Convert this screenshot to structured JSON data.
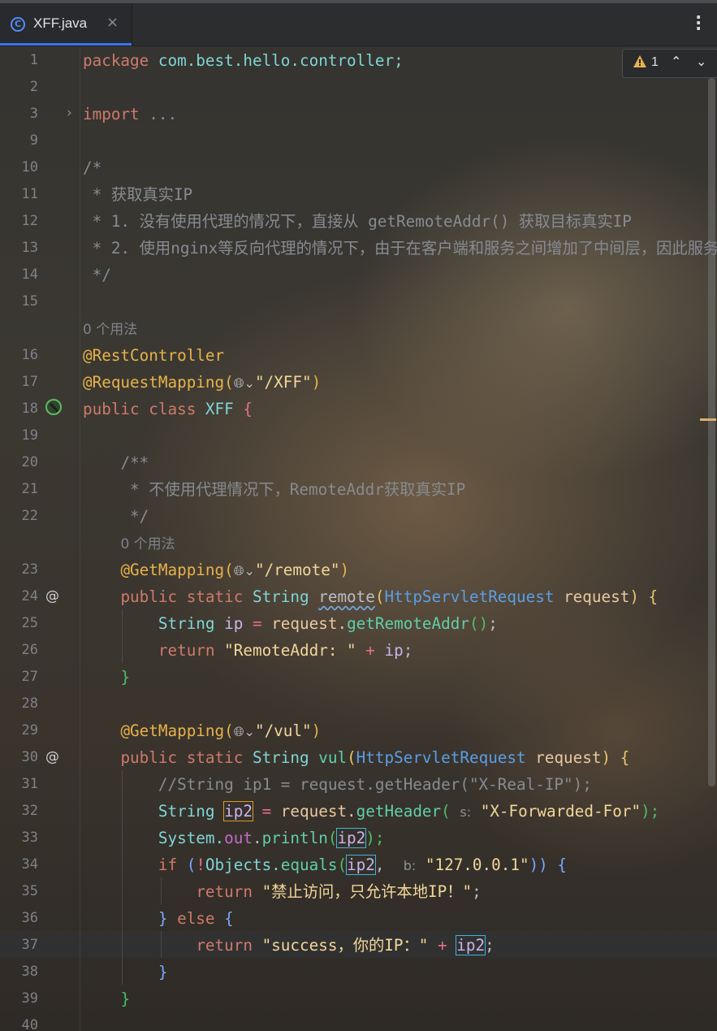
{
  "tab": {
    "file_name": "XFF.java",
    "close_symbol": "×",
    "more_symbol": "⋮"
  },
  "inspection": {
    "warning_count": "1",
    "up": "⌃",
    "down": "⌄"
  },
  "line_numbers": [
    "1",
    "2",
    "3",
    "9",
    "10",
    "11",
    "12",
    "13",
    "14",
    "15",
    "16",
    "17",
    "18",
    "19",
    "20",
    "21",
    "22",
    "23",
    "24",
    "25",
    "26",
    "27",
    "28",
    "29",
    "30",
    "31",
    "32",
    "33",
    "34",
    "35",
    "36",
    "37",
    "38",
    "39",
    "40"
  ],
  "code": {
    "l1_kw": "package",
    "l1_pkg": "com.best.hello.controller;",
    "l3_kw": "import",
    "l3_fold": "...",
    "l10": "/*",
    "l11": " * 获取真实IP",
    "l12": " * 1. 没有使用代理的情况下，直接从 getRemoteAddr() 获取目标真实IP",
    "l13": " * 2. 使用nginx等反向代理的情况下，由于在客户端和服务之间增加了中间层，因此服务",
    "l14": " */",
    "usage1": "0 个用法",
    "l16": "@RestController",
    "l17_ann": "@RequestMapping(",
    "l17_globe": "🌐︎⌄",
    "l17_str": "\"/XFF\"",
    "l17_close": ")",
    "l18_kw": "public class",
    "l18_cls": "XFF",
    "l18_brace": "{",
    "l20": "/**",
    "l21": " * 不使用代理情况下，RemoteAddr获取真实IP",
    "l22": " */",
    "usage2": "0 个用法",
    "l23_ann": "@GetMapping(",
    "l23_str": "\"/remote\"",
    "l23_close": ")",
    "l24_kw": "public static",
    "l24_type": "String",
    "l24_fn": "remote",
    "l24_open": "(",
    "l24_ptype": "HttpServletRequest",
    "l24_param": "request",
    "l24_close": ")",
    "l24_brace": "{",
    "l25_type": "String",
    "l25_var": "ip",
    "l25_eq": "=",
    "l25_obj": "request.",
    "l25_call": "getRemoteAddr",
    "l25_paren": "()",
    "l25_end": ";",
    "l26_kw": "return",
    "l26_str": "\"RemoteAddr: \"",
    "l26_plus": "+",
    "l26_var": "ip",
    "l26_end": ";",
    "l27": "}",
    "l29_ann": "@GetMapping(",
    "l29_str": "\"/vul\"",
    "l29_close": ")",
    "l30_kw": "public static",
    "l30_type": "String",
    "l30_fn": "vul",
    "l30_open": "(",
    "l30_ptype": "HttpServletRequest",
    "l30_param": "request",
    "l30_close": ")",
    "l30_brace": "{",
    "l31": "//String ip1 = request.getHeader(\"X-Real-IP\");",
    "l32_type": "String",
    "l32_var": "ip2",
    "l32_eq": "=",
    "l32_obj": "request.",
    "l32_call": "getHeader",
    "l32_open": "(",
    "l32_hint": "s:",
    "l32_str": "\"X-Forwarded-For\"",
    "l32_close": ");",
    "l33_cls": "System.",
    "l33_fld": "out",
    "l33_dot": ".",
    "l33_call": "println",
    "l33_open": "(",
    "l33_var": "ip2",
    "l33_close": ");",
    "l34_kw": "if",
    "l34_open": "(",
    "l34_not": "!",
    "l34_cls": "Objects.",
    "l34_call": "equals",
    "l34_p": "(",
    "l34_var": "ip2",
    "l34_comma": ",",
    "l34_hint": "b:",
    "l34_str": "\"127.0.0.1\"",
    "l34_close": "))",
    "l34_brace": "{",
    "l35_kw": "return",
    "l35_str": "\"禁止访问，只允许本地IP！\"",
    "l35_end": ";",
    "l36_close": "}",
    "l36_kw": "else",
    "l36_brace": "{",
    "l37_kw": "return",
    "l37_str": "\"success，你的IP：\"",
    "l37_plus": "+",
    "l37_var": "ip2",
    "l37_end": ";",
    "l38": "}",
    "l39": "}"
  },
  "colors": {
    "keyword": "#cf7a6b",
    "annotation": "#e8b24a",
    "string": "#f2d79a",
    "type": "#7fd5d6",
    "comment": "#878b93",
    "accent": "#3574f0"
  }
}
